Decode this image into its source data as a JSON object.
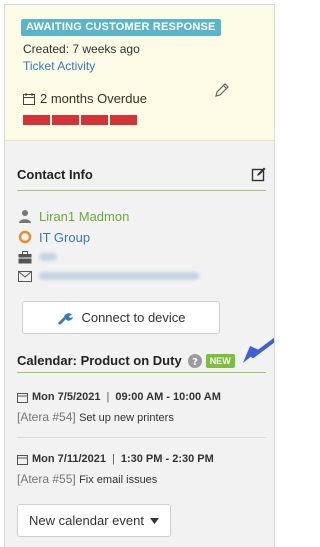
{
  "ticket": {
    "status": "AWAITING CUSTOMER RESPONSE",
    "created": "Created: 7 weeks ago",
    "activity_link": "Ticket Activity",
    "overdue": "2 months Overdue",
    "overdue_level": 4
  },
  "contact": {
    "title": "Contact Info",
    "name": "Liran1 Madmon",
    "company": "IT Group"
  },
  "connect_button": "Connect to device",
  "calendar": {
    "title": "Calendar: Product on Duty",
    "new_badge": "NEW",
    "events": [
      {
        "date": "Mon 7/5/2021",
        "time": "09:00 AM - 10:00 AM",
        "ticket": "[Atera #54]",
        "title": "Set up new printers"
      },
      {
        "date": "Mon 7/11/2021",
        "time": "1:30 PM - 2:30 PM",
        "ticket": "[Atera #55]",
        "title": "Fix email issues"
      }
    ],
    "new_event_button": "New calendar event"
  },
  "colors": {
    "accent_green": "#7cbf3a",
    "link_blue": "#3a79b9",
    "overdue_red": "#d23438",
    "badge_teal": "#5ab5c9"
  }
}
